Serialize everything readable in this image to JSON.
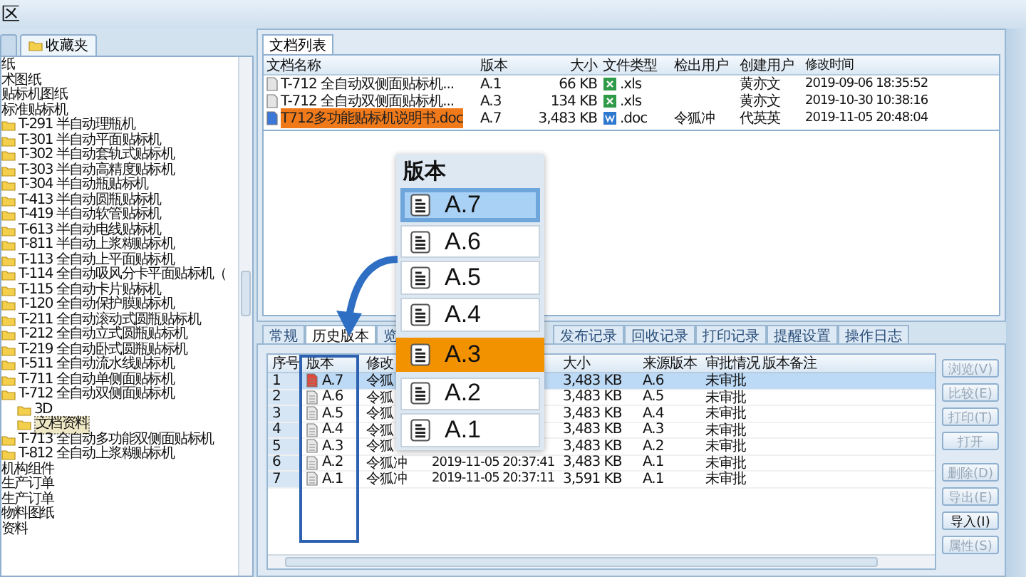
{
  "window": {
    "title": "区"
  },
  "sidebar": {
    "tabs": [
      {
        "selected": false
      },
      {
        "label": "收藏夹",
        "selected": true
      }
    ],
    "tree": [
      {
        "label": "纸",
        "selected": false
      },
      {
        "label": "术图纸",
        "selected": false
      },
      {
        "label": "贴标机图纸",
        "selected": false
      },
      {
        "label": "标准贴标机",
        "selected": false,
        "children": [
          {
            "label": "T-291 半自动理瓶机",
            "selected": false
          },
          {
            "label": "T-301 半自动平面贴标机",
            "selected": false
          },
          {
            "label": "T-302 半自动套轨式贴标机",
            "selected": false
          },
          {
            "label": "T-303 半自动高精度贴标机",
            "selected": false
          },
          {
            "label": "T-304 半自动瓶贴标机",
            "selected": false
          },
          {
            "label": "T-413 半自动圆瓶贴标机",
            "selected": false
          },
          {
            "label": "T-419 半自动软管贴标机",
            "selected": false
          },
          {
            "label": "T-613 半自动电线贴标机",
            "selected": false
          },
          {
            "label": "T-811 半自动上浆糊贴标机",
            "selected": false
          },
          {
            "label": "T-113 全自动上平面贴标机",
            "selected": false
          },
          {
            "label": "T-114 全自动吸风分卡平面贴标机（",
            "selected": false
          },
          {
            "label": "T-115 全自动卡片贴标机",
            "selected": false
          },
          {
            "label": "T-120 全自动保护膜贴标机",
            "selected": false
          },
          {
            "label": "T-211 全自动滚动式圆瓶贴标机",
            "selected": false
          },
          {
            "label": "T-212 全自动立式圆瓶贴标机",
            "selected": false
          },
          {
            "label": "T-219 全自动卧式圆瓶贴标机",
            "selected": false
          },
          {
            "label": "T-511 全自动流水线贴标机",
            "selected": false
          },
          {
            "label": "T-711 全自动单侧面贴标机",
            "selected": false
          },
          {
            "label": "T-712 全自动双侧面贴标机",
            "selected": false,
            "children": [
              {
                "label": "3D",
                "selected": false
              },
              {
                "label": "文档资料",
                "selected": true
              }
            ]
          },
          {
            "label": "T-713 全自动多功能双侧面贴标机",
            "selected": false
          },
          {
            "label": "T-812 全自动上浆糊贴标机",
            "selected": false
          }
        ]
      },
      {
        "label": "机构组件",
        "selected": false
      },
      {
        "label": "生产订单",
        "selected": false
      },
      {
        "label": "生产订单",
        "selected": false
      },
      {
        "label": "物料图纸",
        "selected": false
      },
      {
        "label": "资料",
        "selected": false
      }
    ]
  },
  "document_list": {
    "tab": "文档列表",
    "columns": [
      "文档名称",
      "版本",
      "大小",
      "文件类型",
      "检出用户",
      "创建用户",
      "修改时间"
    ],
    "rows": [
      {
        "kind": "xls",
        "selected": false,
        "cells": [
          "T-712 全自动双侧面贴标机...",
          "A.1",
          "66 KB",
          ".xls",
          "",
          "黄亦文",
          "2019-09-06 18:35:52"
        ]
      },
      {
        "kind": "xls",
        "selected": false,
        "cells": [
          "T-712 全自动双侧面贴标机...",
          "A.3",
          "134 KB",
          ".xls",
          "",
          "黄亦文",
          "2019-10-30 10:38:16"
        ]
      },
      {
        "kind": "doc",
        "selected": true,
        "cells": [
          "T712多功能贴标机说明书.doc",
          "A.7",
          "3,483 KB",
          ".doc",
          "令狐冲",
          "代英英",
          "2019-11-05 20:48:04"
        ]
      }
    ]
  },
  "detail": {
    "tabs": [
      {
        "label": "常规",
        "selected": false
      },
      {
        "label": "历史版本",
        "selected": true
      },
      {
        "label": "览",
        "selected": false
      },
      {
        "label": "发布记录",
        "selected": false
      },
      {
        "label": "回收记录",
        "selected": false
      },
      {
        "label": "打印记录",
        "selected": false
      },
      {
        "label": "提醒设置",
        "selected": false
      },
      {
        "label": "操作日志",
        "selected": false
      }
    ],
    "columns": [
      {
        "label": "序号"
      },
      {
        "label": "版本"
      },
      {
        "label": "修改"
      },
      {},
      {
        "label": "大小"
      },
      {
        "label": "来源版本"
      },
      {
        "label": "审批情况"
      },
      {
        "label": "版本备注"
      }
    ],
    "rows": [
      {
        "selected": true,
        "checked_out": true,
        "cells": [
          "1",
          "A.7",
          "令狐",
          "",
          "3,483 KB",
          "A.6",
          "未审批"
        ]
      },
      {
        "selected": false,
        "checked_out": false,
        "cells": [
          "2",
          "A.6",
          "令狐",
          "",
          "3,483 KB",
          "A.5",
          "未审批"
        ]
      },
      {
        "selected": false,
        "checked_out": false,
        "cells": [
          "3",
          "A.5",
          "令狐",
          "",
          "3,483 KB",
          "A.4",
          "未审批"
        ]
      },
      {
        "selected": false,
        "checked_out": false,
        "cells": [
          "4",
          "A.4",
          "令狐",
          "",
          "3,483 KB",
          "A.3",
          "未审批"
        ]
      },
      {
        "selected": false,
        "checked_out": false,
        "cells": [
          "5",
          "A.3",
          "令狐",
          "",
          "3,483 KB",
          "A.2",
          "未审批"
        ]
      },
      {
        "selected": false,
        "checked_out": false,
        "cells": [
          "6",
          "A.2",
          "令狐冲",
          "2019-11-05 20:37:41",
          "3,483 KB",
          "A.1",
          "未审批"
        ]
      },
      {
        "selected": false,
        "checked_out": false,
        "cells": [
          "7",
          "A.1",
          "令狐冲",
          "2019-11-05 20:37:11",
          "3,591 KB",
          "A.1",
          "未审批"
        ]
      }
    ],
    "buttons": [
      {
        "label": "浏览(V)",
        "disabled": true
      },
      {
        "label": "比较(E)",
        "disabled": true
      },
      {
        "label": "打印(T)",
        "disabled": true
      },
      {
        "label": "打开",
        "disabled": true
      },
      {
        "label": "删除(D)",
        "disabled": true
      },
      {
        "label": "导出(E)",
        "disabled": true
      },
      {
        "label": "导入(I)",
        "disabled": false
      },
      {
        "label": "属性(S)",
        "disabled": true
      }
    ]
  },
  "callout": {
    "title": "版本",
    "items": [
      {
        "label": "A.7",
        "selected": true,
        "highlighted": false
      },
      {
        "label": "A.6",
        "selected": false,
        "highlighted": false
      },
      {
        "label": "A.5",
        "selected": false,
        "highlighted": false
      },
      {
        "label": "A.4",
        "selected": false,
        "highlighted": false
      },
      {
        "label": "A.3",
        "selected": false,
        "highlighted": true
      },
      {
        "label": "A.2",
        "selected": false,
        "highlighted": false
      },
      {
        "label": "A.1",
        "selected": false,
        "highlighted": false
      }
    ]
  }
}
